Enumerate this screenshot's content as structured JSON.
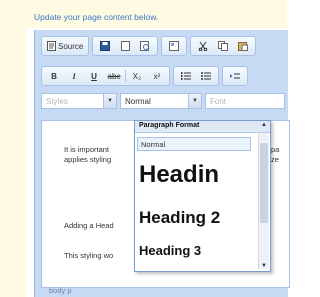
{
  "instruction": "Update your page content below.",
  "toolbar": {
    "source_label": "Source",
    "bold_label": "B",
    "italic_label": "I",
    "underline_label": "U",
    "strike_label": "abc",
    "subscript_label": "X₂",
    "superscript_label": "x²"
  },
  "combos": {
    "styles": "Styles",
    "format": "Normal",
    "font": "Font"
  },
  "content": {
    "line1a": "It is important",
    "line1b": "applies styling",
    "line2": "Adding a Head",
    "line3": "This styling wo",
    "right1": "pa",
    "right2": "ze"
  },
  "status": "body p",
  "dropdown": {
    "title": "Paragraph Format",
    "items": [
      "Normal",
      "Headin",
      "Heading 2",
      "Heading 3"
    ]
  }
}
